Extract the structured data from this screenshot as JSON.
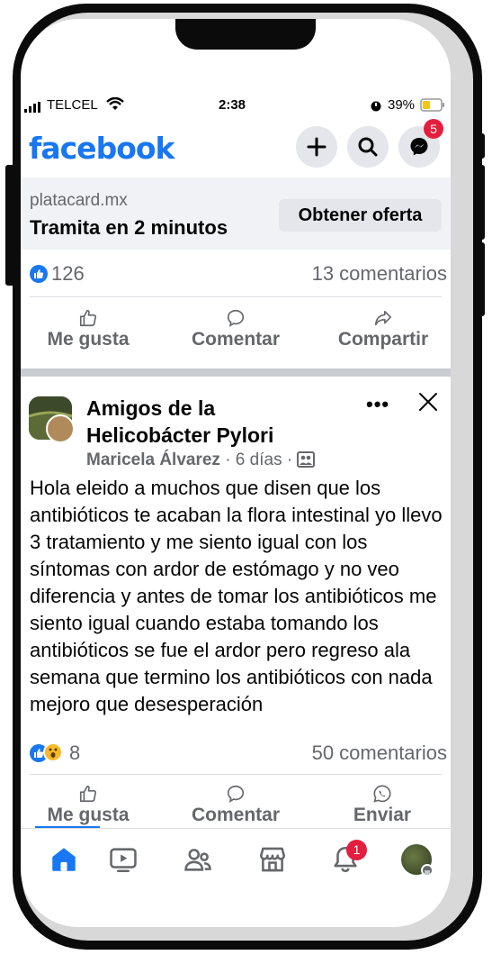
{
  "status_bar": {
    "carrier": "TELCEL",
    "time": "2:38",
    "battery": "39%"
  },
  "header": {
    "logo": "facebook",
    "messenger_badge": "5",
    "icons": [
      "plus-icon",
      "search-icon",
      "messenger-icon"
    ]
  },
  "ad": {
    "domain": "platacard.mx",
    "tagline": "Tramita en 2 minutos",
    "cta": "Obtener oferta"
  },
  "ad_stats": {
    "reactions": "126",
    "comments": "13 comentarios"
  },
  "ad_actions": {
    "like": "Me gusta",
    "comment": "Comentar",
    "share": "Compartir"
  },
  "post": {
    "group": "Amigos de la Helicobácter Pylori",
    "author": "Maricela Álvarez",
    "time": " · 6 días · ",
    "text": "Hola eleido a muchos que disen que los antibióticos te acaban la flora intestinal yo llevo 3 tratamiento y me siento igual con los síntomas con ardor de estómago y no veo diferencia y antes de tomar los antibióticos me siento igual cuando estaba tomando los antibióticos se fue el ardor pero regreso ala semana que termino los antibióticos con nada mejoro que desesperación",
    "reactions": "8",
    "comments": "50 comentarios"
  },
  "post_actions": {
    "like": "Me gusta",
    "comment": "Comentar",
    "send": "Enviar"
  },
  "bottom_nav": {
    "notifications_badge": "1",
    "tabs": [
      "home-icon",
      "video-icon",
      "friends-icon",
      "marketplace-icon",
      "notifications-icon",
      "profile-avatar"
    ]
  },
  "colors": {
    "brand": "#1877f2",
    "badge": "#e41e3f",
    "text_secondary": "#65676b"
  }
}
